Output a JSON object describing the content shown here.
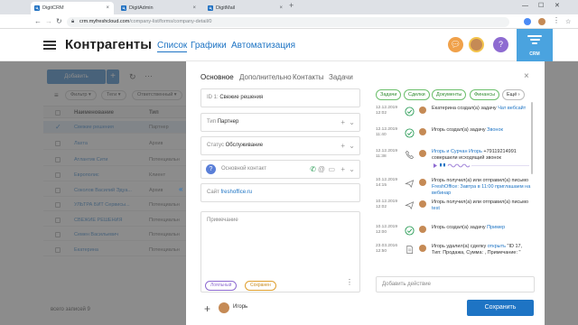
{
  "browser": {
    "tabs": [
      {
        "label": "DigitCRM"
      },
      {
        "label": "DigitAdmin"
      },
      {
        "label": "DigitMail"
      }
    ],
    "url_host": "crm.myfreshcloud.com",
    "url_path": "/company-list/forms/company-detail/0"
  },
  "header": {
    "title": "Контрагенты",
    "nav": [
      {
        "label": "Список"
      },
      {
        "label": "Графики"
      },
      {
        "label": "Автоматизация"
      }
    ],
    "help": "?",
    "logo": "CRM",
    "colors": {
      "accent": "#1e74c4",
      "chat": "#f0a14a",
      "help": "#8e6bd1",
      "logo": "#4aa3df"
    }
  },
  "list": {
    "add_button": "Добавить",
    "add_plus": "+",
    "more": "···",
    "filters": [
      {
        "label": "Фильтр"
      },
      {
        "label": "Теги"
      },
      {
        "label": "Ответственный"
      }
    ],
    "col_name": "Наименование",
    "col_type": "Тип",
    "rows": [
      {
        "name": "Свежие решения",
        "type": "Партнер"
      },
      {
        "name": "Лахта",
        "type": "Архив"
      },
      {
        "name": "Атлантик Сити",
        "type": "Потенциальн"
      },
      {
        "name": "Европолис",
        "type": "Клиент"
      },
      {
        "name": "Соколов Василий Эдуа...",
        "type": "Архив"
      },
      {
        "name": "УЛЬТРА БИТ Сервисы...",
        "type": "Потенциальн"
      },
      {
        "name": "СВЕЖИЕ РЕШЕНИЯ",
        "type": "Потенциальн"
      },
      {
        "name": "Семен Васильевич",
        "type": "Потенциальн"
      },
      {
        "name": "Екатерина",
        "type": "Потенциальн"
      }
    ],
    "total": "всего записей 9"
  },
  "panel": {
    "tabs": [
      {
        "label": "Основное"
      },
      {
        "label": "Дополнительно"
      },
      {
        "label": "Контакты"
      },
      {
        "label": "Задачи"
      }
    ],
    "close": "×",
    "id_label": "ID 1:",
    "id_value": "Свежие решения",
    "type_label": "Тип",
    "type_value": "Партнер",
    "status_label": "Статус",
    "status_value": "Обслуживание",
    "contact_label": "Основной контакт",
    "site_label": "Сайт",
    "site_value": "freshoffice.ru",
    "notes_label": "Примечание",
    "tags": [
      {
        "label": "Лояльный",
        "color": "#8e6bd1"
      },
      {
        "label": "Сохранен",
        "color": "#e0a030"
      }
    ],
    "notes_more": "⋮",
    "add_plus": "+",
    "user": "Игорь",
    "save": "Сохранить"
  },
  "feed": {
    "chips": [
      {
        "label": "Задачи"
      },
      {
        "label": "Сделки"
      },
      {
        "label": "Документы"
      },
      {
        "label": "Финансы"
      },
      {
        "label": "Ещё"
      }
    ],
    "items": [
      {
        "date": "12.12.2019",
        "time": "12:02",
        "icon": "check-icon",
        "pre": "Екатерина создал(а) задачу ",
        "link": "Чат вебсайт",
        "post": ""
      },
      {
        "date": "12.12.2019",
        "time": "11:40",
        "icon": "check-icon",
        "pre": "Игорь создал(а) задачу ",
        "link": "Звонок",
        "post": ""
      },
      {
        "date": "12.12.2019",
        "time": "11:38",
        "icon": "phone-icon",
        "pre": "",
        "link": "Игорь и Сурчан Игорь",
        "post": " +79119214991 совершили исходящий звонок"
      },
      {
        "date": "10.12.2019",
        "time": "14:15",
        "icon": "send-icon",
        "pre": "Игорь получил(а) или отправил(а) письмо ",
        "link": "FreshOffice: Завтра в 11:00 приглашаем на вебинар",
        "post": ""
      },
      {
        "date": "10.12.2019",
        "time": "12:02",
        "icon": "send-icon",
        "pre": "Игорь получил(а) или отправил(а) письмо ",
        "link": "test",
        "post": ""
      },
      {
        "date": "10.12.2019",
        "time": "12:00",
        "icon": "check-icon",
        "pre": "Игорь создал(а) задачу ",
        "link": "Пример",
        "post": ""
      },
      {
        "date": "23.03.2016",
        "time": "12:50",
        "icon": "doc-icon",
        "pre": "Игорь удалил(а) сделку ",
        "link": "открыть",
        "post": " \"ID 17, Тип: Продажа, Сумма: , Примечание: \""
      }
    ],
    "add_action": "Добавить действие"
  }
}
